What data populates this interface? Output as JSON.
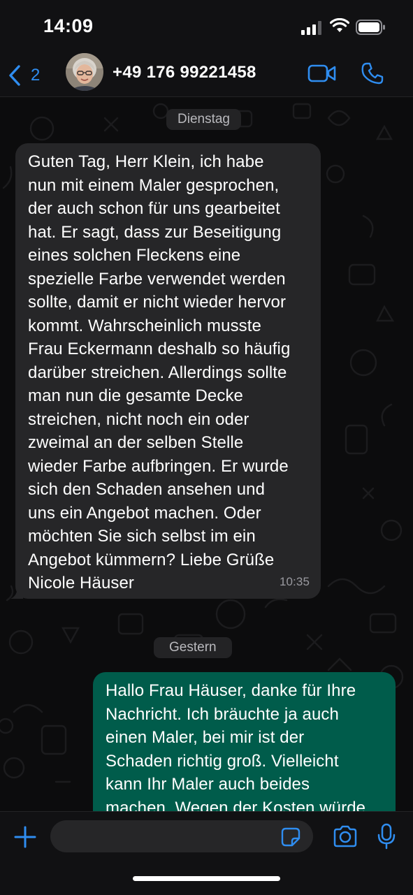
{
  "status_bar": {
    "time": "14:09"
  },
  "header": {
    "back_count": "2",
    "contact_name": "+49 176 99221458"
  },
  "chat": {
    "date_1": "Dienstag",
    "incoming_message": {
      "lines": [
        "Guten Tag, Herr Klein, ich habe",
        "nun mit einem Maler gesprochen,",
        "der auch schon für uns gearbeitet",
        "hat. Er sagt, dass zur Beseitigung",
        "eines solchen Fleckens eine",
        "spezielle Farbe verwendet werden",
        "sollte, damit er nicht wieder hervor",
        "kommt. Wahrscheinlich musste",
        "Frau Eckermann deshalb so häufig",
        "darüber streichen. Allerdings sollte",
        "man nun die gesamte Decke",
        "streichen, nicht noch ein oder",
        "zweimal an der selben Stelle",
        "wieder Farbe aufbringen. Er wurde",
        "sich den Schaden ansehen und",
        "uns ein Angebot machen. Oder",
        "möchten Sie sich selbst im ein",
        "Angebot kümmern? Liebe Grüße",
        "Nicole Häuser"
      ],
      "time": "10:35"
    },
    "date_2": "Gestern",
    "outgoing_message": {
      "lines": [
        "Hallo Frau Häuser, danke für Ihre",
        "Nachricht. Ich bräuchte ja auch",
        "einen Maler, bei mir ist der",
        "Schaden richtig groß. Vielleicht",
        "kann Ihr Maler auch beides",
        "machen. Wegen der Kosten würde"
      ]
    }
  },
  "input_bar": {
    "value": "",
    "placeholder": ""
  },
  "colors": {
    "accent": "#2f8df0",
    "incoming_bubble": "#262628",
    "outgoing_bubble": "#005c4b",
    "background": "#0c0c0d"
  },
  "icons": [
    "signal-icon",
    "wifi-icon",
    "battery-icon",
    "chevron-left-icon",
    "video-call-icon",
    "phone-icon",
    "plus-icon",
    "sticker-icon",
    "camera-icon",
    "microphone-icon"
  ]
}
